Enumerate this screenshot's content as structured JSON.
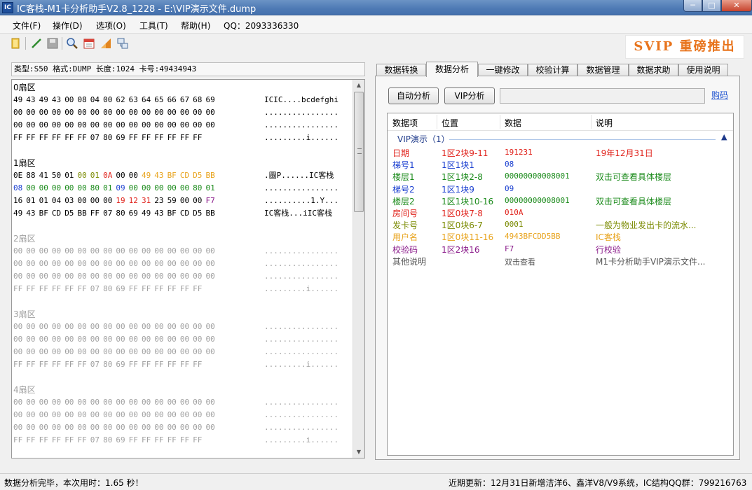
{
  "window": {
    "title": "IC客栈-M1卡分析助手V2.8_1228 - E:\\VIP演示文件.dump",
    "min": "─",
    "max": "□",
    "close": "✕"
  },
  "menu": [
    "文件(F)",
    "操作(D)",
    "选项(O)",
    "工具(T)",
    "帮助(H)",
    "QQ：2093336330"
  ],
  "banner": "SVIP 重磅推出",
  "card_info": "类型:S50 格式:DUMP 长度:1024 卡号:49434943",
  "sectors": [
    {
      "title": "0扇区",
      "grey": false,
      "rows": [
        {
          "hex": [
            "49",
            "43",
            "49",
            "43",
            "00",
            "08",
            "04",
            "00",
            "62",
            "63",
            "64",
            "65",
            "66",
            "67",
            "68",
            "69"
          ],
          "ascii": "ICIC....bcdefghi"
        },
        {
          "hex": [
            "00",
            "00",
            "00",
            "00",
            "00",
            "00",
            "00",
            "00",
            "00",
            "00",
            "00",
            "00",
            "00",
            "00",
            "00",
            "00"
          ],
          "ascii": "................"
        },
        {
          "hex": [
            "00",
            "00",
            "00",
            "00",
            "00",
            "00",
            "00",
            "00",
            "00",
            "00",
            "00",
            "00",
            "00",
            "00",
            "00",
            "00"
          ],
          "ascii": "................"
        },
        {
          "hex": [
            "FF",
            "FF",
            "FF",
            "FF",
            "FF",
            "FF",
            "07",
            "80",
            "69",
            "FF",
            "FF",
            "FF",
            "FF",
            "FF",
            "FF"
          ],
          "ascii": ".........i......"
        }
      ]
    },
    {
      "title": "1扇区",
      "grey": false,
      "rows": [
        {
          "hex": [
            "0E",
            "88",
            "41",
            "50",
            "01",
            "00",
            "01",
            "0A",
            "00",
            "00",
            "49",
            "43",
            "BF",
            "CD",
            "D5",
            "BB"
          ],
          "colors": [
            "",
            "",
            "",
            "",
            "",
            "#7a8a00",
            "#7a8a00",
            "#e0231c",
            "",
            "",
            "#e8a31c",
            "#e8a31c",
            "#e8a31c",
            "#e8a31c",
            "#e8a31c",
            "#e8a31c"
          ],
          "ascii": ".圖P......IC客栈"
        },
        {
          "hex": [
            "08",
            "00",
            "00",
            "00",
            "00",
            "00",
            "80",
            "01",
            "09",
            "00",
            "00",
            "00",
            "00",
            "00",
            "80",
            "01"
          ],
          "colors": [
            "#1a3fd0",
            "#1a8a1a",
            "#1a8a1a",
            "#1a8a1a",
            "#1a8a1a",
            "#1a8a1a",
            "#1a8a1a",
            "#1a8a1a",
            "#1a3fd0",
            "#1a8a1a",
            "#1a8a1a",
            "#1a8a1a",
            "#1a8a1a",
            "#1a8a1a",
            "#1a8a1a",
            "#1a8a1a"
          ],
          "ascii": "................"
        },
        {
          "hex": [
            "16",
            "01",
            "01",
            "04",
            "03",
            "00",
            "00",
            "00",
            "19",
            "12",
            "31",
            "23",
            "59",
            "00",
            "00",
            "F7"
          ],
          "colors": [
            "",
            "",
            "",
            "",
            "",
            "",
            "",
            "",
            "#e0231c",
            "#e0231c",
            "#e0231c",
            "",
            "",
            "",
            "",
            "#8a1a8a"
          ],
          "ascii": "..........1.Y..."
        },
        {
          "hex": [
            "49",
            "43",
            "BF",
            "CD",
            "D5",
            "BB",
            "FF",
            "07",
            "80",
            "69",
            "49",
            "43",
            "BF",
            "CD",
            "D5",
            "BB"
          ],
          "ascii": "IC客栈...iIC客栈"
        }
      ]
    },
    {
      "title": "2扇区",
      "grey": true,
      "rows": [
        {
          "hex": [
            "00",
            "00",
            "00",
            "00",
            "00",
            "00",
            "00",
            "00",
            "00",
            "00",
            "00",
            "00",
            "00",
            "00",
            "00",
            "00"
          ],
          "ascii": "................"
        },
        {
          "hex": [
            "00",
            "00",
            "00",
            "00",
            "00",
            "00",
            "00",
            "00",
            "00",
            "00",
            "00",
            "00",
            "00",
            "00",
            "00",
            "00"
          ],
          "ascii": "................"
        },
        {
          "hex": [
            "00",
            "00",
            "00",
            "00",
            "00",
            "00",
            "00",
            "00",
            "00",
            "00",
            "00",
            "00",
            "00",
            "00",
            "00",
            "00"
          ],
          "ascii": "................"
        },
        {
          "hex": [
            "FF",
            "FF",
            "FF",
            "FF",
            "FF",
            "FF",
            "07",
            "80",
            "69",
            "FF",
            "FF",
            "FF",
            "FF",
            "FF",
            "FF"
          ],
          "ascii": ".........i......"
        }
      ]
    },
    {
      "title": "3扇区",
      "grey": true,
      "rows": [
        {
          "hex": [
            "00",
            "00",
            "00",
            "00",
            "00",
            "00",
            "00",
            "00",
            "00",
            "00",
            "00",
            "00",
            "00",
            "00",
            "00",
            "00"
          ],
          "ascii": "................"
        },
        {
          "hex": [
            "00",
            "00",
            "00",
            "00",
            "00",
            "00",
            "00",
            "00",
            "00",
            "00",
            "00",
            "00",
            "00",
            "00",
            "00",
            "00"
          ],
          "ascii": "................"
        },
        {
          "hex": [
            "00",
            "00",
            "00",
            "00",
            "00",
            "00",
            "00",
            "00",
            "00",
            "00",
            "00",
            "00",
            "00",
            "00",
            "00",
            "00"
          ],
          "ascii": "................"
        },
        {
          "hex": [
            "FF",
            "FF",
            "FF",
            "FF",
            "FF",
            "FF",
            "07",
            "80",
            "69",
            "FF",
            "FF",
            "FF",
            "FF",
            "FF",
            "FF"
          ],
          "ascii": ".........i......"
        }
      ]
    },
    {
      "title": "4扇区",
      "grey": true,
      "rows": [
        {
          "hex": [
            "00",
            "00",
            "00",
            "00",
            "00",
            "00",
            "00",
            "00",
            "00",
            "00",
            "00",
            "00",
            "00",
            "00",
            "00",
            "00"
          ],
          "ascii": "................"
        },
        {
          "hex": [
            "00",
            "00",
            "00",
            "00",
            "00",
            "00",
            "00",
            "00",
            "00",
            "00",
            "00",
            "00",
            "00",
            "00",
            "00",
            "00"
          ],
          "ascii": "................"
        },
        {
          "hex": [
            "00",
            "00",
            "00",
            "00",
            "00",
            "00",
            "00",
            "00",
            "00",
            "00",
            "00",
            "00",
            "00",
            "00",
            "00",
            "00"
          ],
          "ascii": "................"
        },
        {
          "hex": [
            "FF",
            "FF",
            "FF",
            "FF",
            "FF",
            "FF",
            "07",
            "80",
            "69",
            "FF",
            "FF",
            "FF",
            "FF",
            "FF",
            "FF"
          ],
          "ascii": ".........i......"
        }
      ]
    }
  ],
  "tabs": [
    "数据转换",
    "数据分析",
    "一键修改",
    "校验计算",
    "数据管理",
    "数据求助",
    "使用说明"
  ],
  "active_tab": "数据分析",
  "buttons": {
    "auto": "自动分析",
    "vip": "VIP分析"
  },
  "buy_link": "购码",
  "grid": {
    "columns": [
      "数据项",
      "位置",
      "数据",
      "说明"
    ],
    "group": "VIP演示（1）",
    "collapse_icon": "chevron-up-icon",
    "rows": [
      {
        "item": "日期",
        "pos": "1区2块9-11",
        "data": "191231",
        "desc": "19年12月31日",
        "color": "#e0231c"
      },
      {
        "item": "梯号1",
        "pos": "1区1块1",
        "data": "08",
        "desc": "",
        "color": "#1a3fd0"
      },
      {
        "item": "楼层1",
        "pos": "1区1块2-8",
        "data": "00000000008001",
        "desc": "双击可查看具体楼层",
        "color": "#1a8a1a"
      },
      {
        "item": "梯号2",
        "pos": "1区1块9",
        "data": "09",
        "desc": "",
        "color": "#1a3fd0"
      },
      {
        "item": "楼层2",
        "pos": "1区1块10-16",
        "data": "00000000008001",
        "desc": "双击可查看具体楼层",
        "color": "#1a8a1a"
      },
      {
        "item": "房间号",
        "pos": "1区0块7-8",
        "data": "010A",
        "desc": "",
        "color": "#e0231c"
      },
      {
        "item": "发卡号",
        "pos": "1区0块6-7",
        "data": "0001",
        "desc": "一般为物业发出卡的流水...",
        "color": "#7a8a00"
      },
      {
        "item": "用户名",
        "pos": "1区0块11-16",
        "data": "4943BFCDD5BB",
        "desc": "IC客栈",
        "color": "#e8a31c"
      },
      {
        "item": "校验码",
        "pos": "1区2块16",
        "data": "F7",
        "desc": "行校验",
        "color": "#8a1a8a"
      },
      {
        "item": "其他说明",
        "pos": "",
        "data": "双击查看",
        "desc": "M1卡分析助手VIP演示文件...",
        "color": "#555555"
      }
    ]
  },
  "status": {
    "left": "数据分析完毕，本次用时：1.65 秒！",
    "right": "近期更新：12月31日新增洁洋6、鑫洋V8/V9系统，IC结构QQ群：799216763"
  }
}
